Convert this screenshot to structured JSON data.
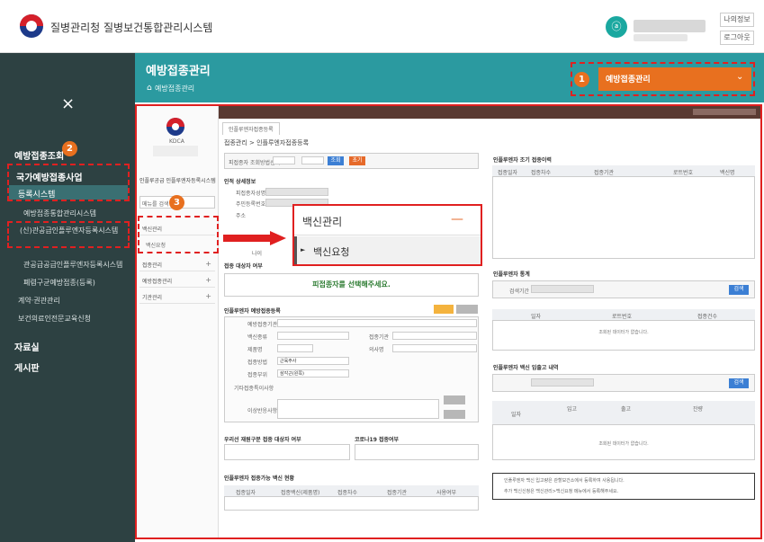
{
  "header": {
    "app_title": "질병관리청 질병보건통합관리시스템",
    "avatar_glyph": "ⓐ",
    "btn_myinfo": "나의정보",
    "btn_logout": "로그아웃"
  },
  "sidebar": {
    "close": "×",
    "section1": "예방접종조회",
    "section1_badge": "2",
    "group": "국가예방접종사업",
    "active_item": "등록시스템",
    "item_a": "예방접종통합관리시스템",
    "item_b": "(신)관공급인플루엔자등록시스템",
    "item_c": "관공급공급인플루엔자등록시스템",
    "item_d": "폐렴구균예방접종(등록)",
    "item_e": "계약·권관관리",
    "item_f": "보건의료인전문교육신청",
    "section2": "자료실",
    "section3": "게시판"
  },
  "page_header": {
    "title": "예방접종관리",
    "breadcrumb": "예방접종관리",
    "home_icon": "⌂",
    "dropdown_label": "예방접종관리",
    "dropdown_badge": "1",
    "chevron": "⌄"
  },
  "inner_nav": {
    "org_name": "KDCA",
    "system_title": "인플루공급 인플루엔자등록시스템",
    "search_placeholder": "메뉴를 검색",
    "badge": "3",
    "menu1": "백신관리",
    "menu1_sub": "백신요청",
    "menu2": "접종관리",
    "menu3": "예방접종관리",
    "menu4": "기관관리",
    "plus": "+"
  },
  "tab": {
    "label": "인플루엔자접종등록"
  },
  "form": {
    "breadcrumb": "접종관리 > 인플루엔자접종등록",
    "search_label": "피접종자 조회방법선택",
    "btn_search": "조회",
    "btn_reset": "초기",
    "sec_personal": "인적 상세정보",
    "lbl_name": "피접종자성명",
    "lbl_rrn": "주민등록번호",
    "lbl_address": "주소",
    "lbl_age": "나이",
    "sec_eligible": "접종 대상자 여부",
    "green_msg": "피접종자를 선택해주세요.",
    "sec_vaccine": "인플루엔자 예방접종등록",
    "lbl_date": "예방접종기관",
    "lbl_vaccine": "백신종류",
    "lbl_brand": "제품명",
    "lbl_lot": "접종방법",
    "lbl_site": "접종부위",
    "lbl_inst": "접종기관",
    "lbl_doctor": "의사명",
    "lbl_etc": "기타접종특이사항",
    "lbl_memo": "이상반응사항",
    "val_route": "근육주사",
    "val_site": "삼각근(왼쪽)",
    "sec_payer": "우리선 재원구분 접종 대상자 여부",
    "sec_covid": "코로나19 접종여부",
    "sec_schedule": "인플루엔자 접종가능 백신 현황",
    "col1": "접종일자",
    "col2": "접종백신(제품명)",
    "col3": "접종차수",
    "col4": "접종기관",
    "col5": "사용여부"
  },
  "right_panel": {
    "sec_history": "인플루엔자 조기 접종이력",
    "col_date": "접종일자",
    "col_count": "접종차수",
    "col_inst": "접종기관",
    "col_lot": "로트번호",
    "col_vax": "백신명",
    "sec_stats": "인플루엔자 통계",
    "lbl_period": "검색기간",
    "btn_query": "검색",
    "col_day": "일자",
    "col_lotno": "로트번호",
    "col_qty": "접종건수",
    "empty_text": "조회된 데이터가 없습니다.",
    "sec_stock": "인플루엔자 백신 입출고 내역",
    "col_in": "입고",
    "col_out": "출고",
    "col_balance": "잔량",
    "note1": "인플루엔자 백신 입고량은 관할보건소에서 등록하여 사용됩니다.",
    "note2": "추가 백신신청은 백신관리>백신요청 메뉴에서 등록해주세요."
  },
  "popup": {
    "title": "백신관리",
    "dash": "—",
    "item": "백신요청",
    "item_arrow": "►"
  }
}
